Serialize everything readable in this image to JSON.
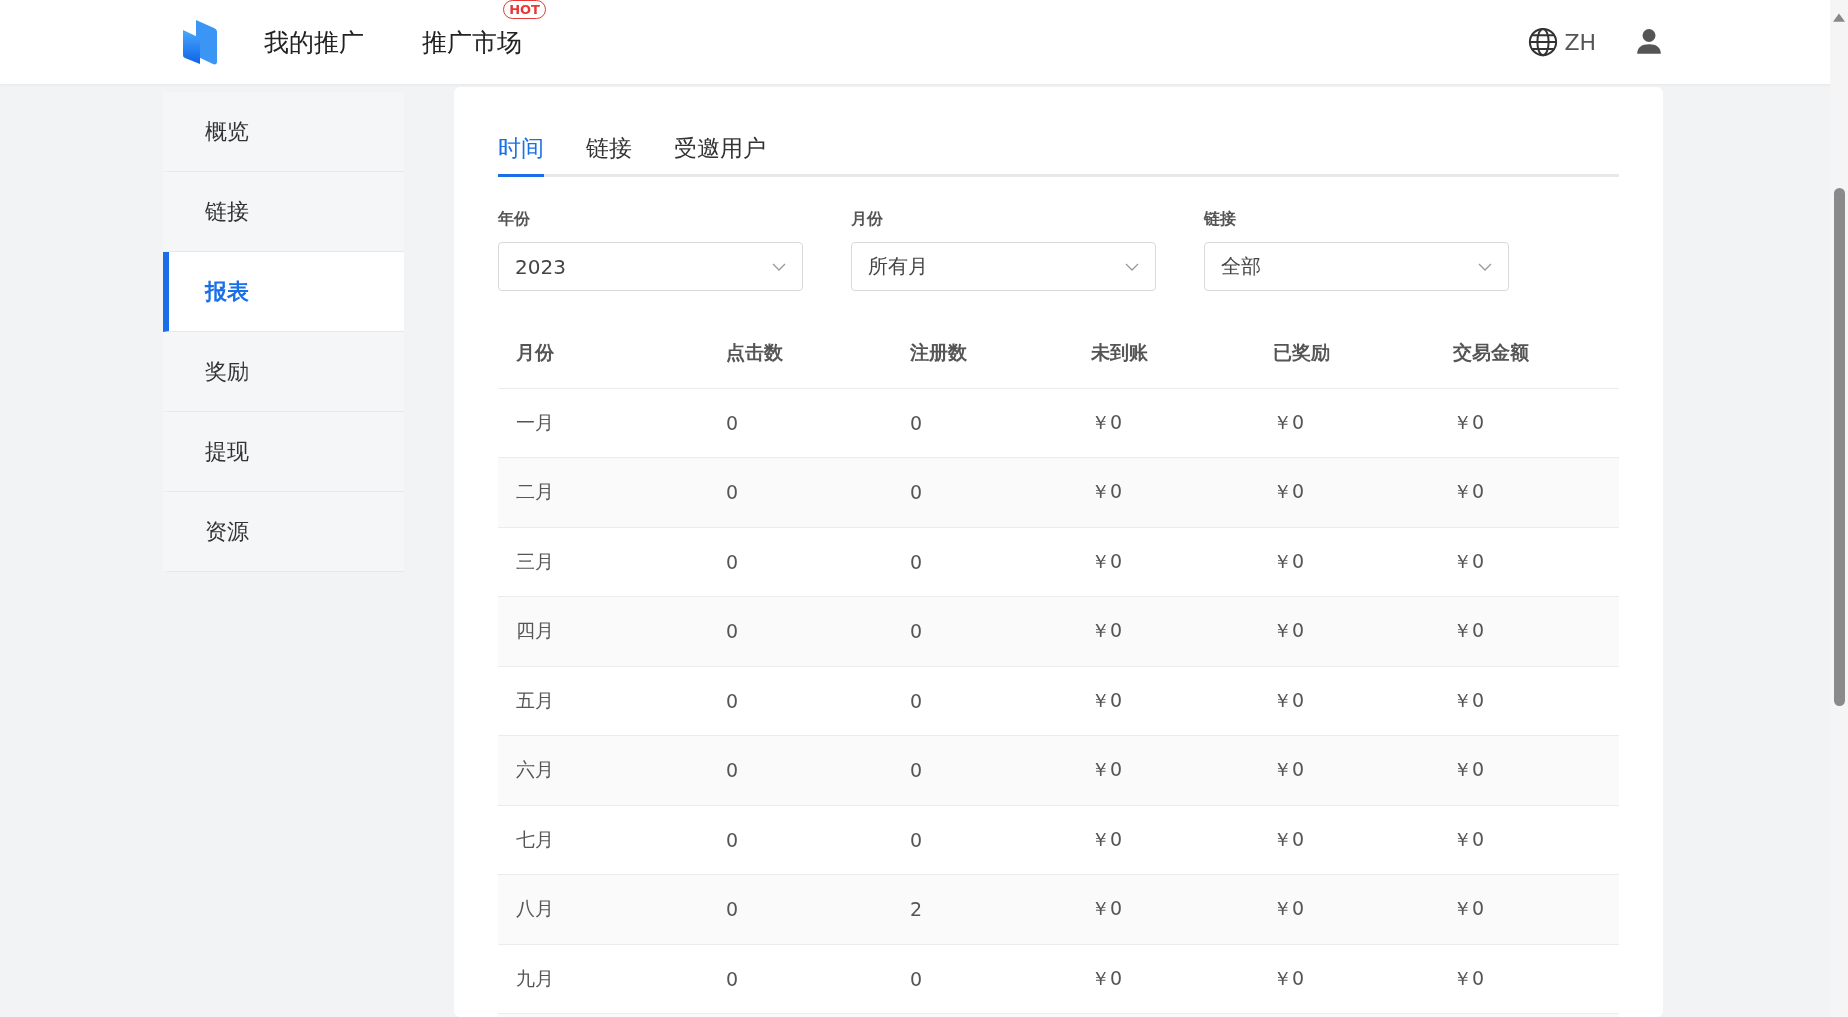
{
  "header": {
    "nav": [
      {
        "label": "我的推广"
      },
      {
        "label": "推广市场",
        "badge": "HOT"
      }
    ],
    "language": "ZH"
  },
  "sidebar": {
    "items": [
      {
        "label": "概览",
        "selected": false
      },
      {
        "label": "链接",
        "selected": false
      },
      {
        "label": "报表",
        "selected": true
      },
      {
        "label": "奖励",
        "selected": false
      },
      {
        "label": "提现",
        "selected": false
      },
      {
        "label": "资源",
        "selected": false
      }
    ]
  },
  "tabs": [
    {
      "label": "时间",
      "selected": true
    },
    {
      "label": "链接",
      "selected": false
    },
    {
      "label": "受邀用户",
      "selected": false
    }
  ],
  "filters": [
    {
      "label": "年份",
      "value": "2023"
    },
    {
      "label": "月份",
      "value": "所有月"
    },
    {
      "label": "链接",
      "value": "全部"
    }
  ],
  "table": {
    "columns": [
      "月份",
      "点击数",
      "注册数",
      "未到账",
      "已奖励",
      "交易金额"
    ],
    "rows": [
      [
        "一月",
        "0",
        "0",
        "￥0",
        "￥0",
        "￥0"
      ],
      [
        "二月",
        "0",
        "0",
        "￥0",
        "￥0",
        "￥0"
      ],
      [
        "三月",
        "0",
        "0",
        "￥0",
        "￥0",
        "￥0"
      ],
      [
        "四月",
        "0",
        "0",
        "￥0",
        "￥0",
        "￥0"
      ],
      [
        "五月",
        "0",
        "0",
        "￥0",
        "￥0",
        "￥0"
      ],
      [
        "六月",
        "0",
        "0",
        "￥0",
        "￥0",
        "￥0"
      ],
      [
        "七月",
        "0",
        "0",
        "￥0",
        "￥0",
        "￥0"
      ],
      [
        "八月",
        "0",
        "2",
        "￥0",
        "￥0",
        "￥0"
      ],
      [
        "九月",
        "0",
        "0",
        "￥0",
        "￥0",
        "￥0"
      ]
    ]
  }
}
